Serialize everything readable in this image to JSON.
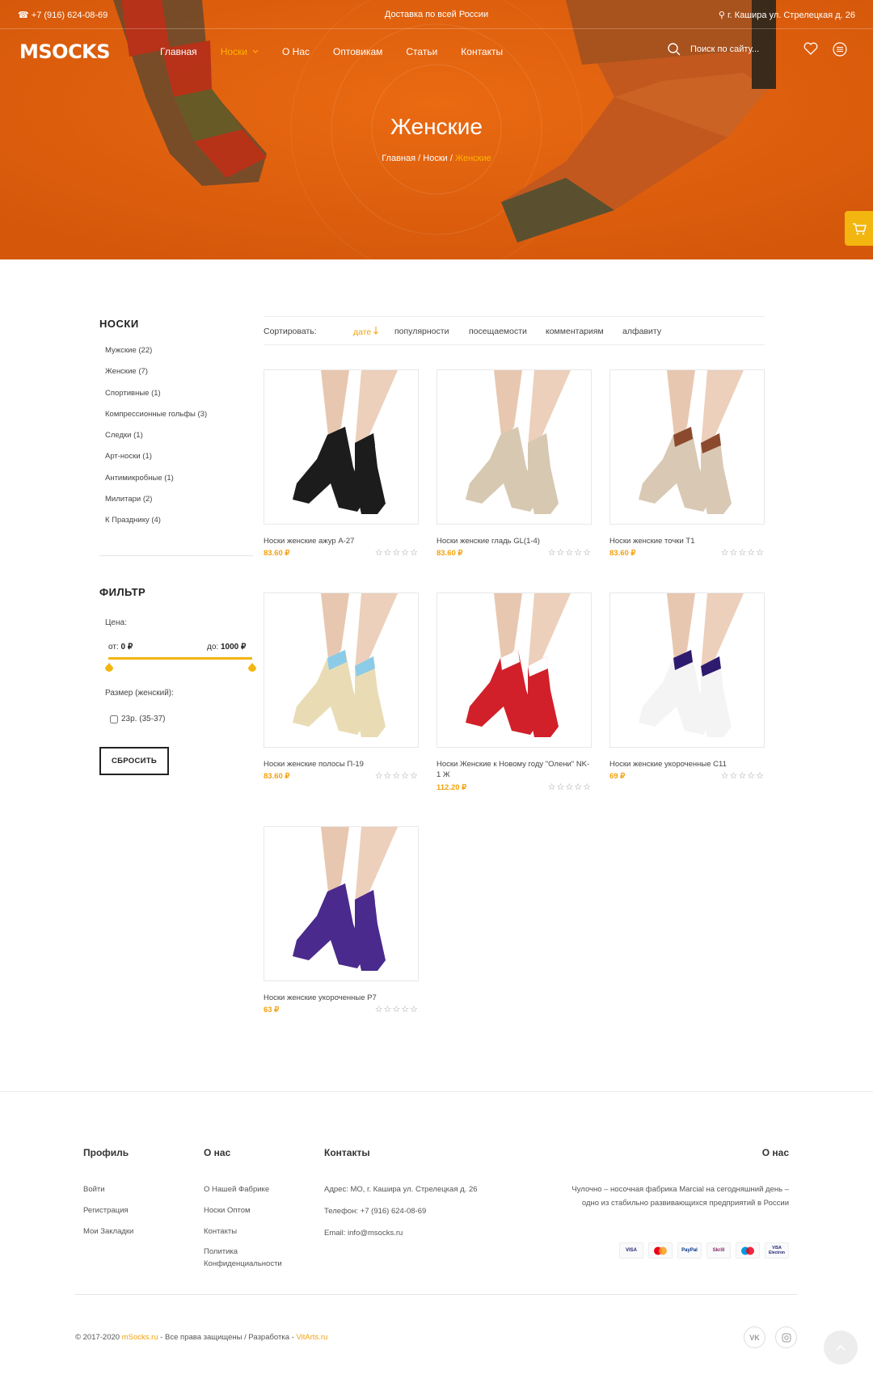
{
  "topbar": {
    "phone": "+7 (916) 624-08-69",
    "delivery": "Доставка по всей России",
    "address": "г. Кашира ул. Стрелецкая д. 26"
  },
  "header": {
    "logo": "MSOCKS",
    "menu": [
      "Главная",
      "Носки",
      "О Нас",
      "Оптовикам",
      "Статьи",
      "Контакты"
    ],
    "search_placeholder": "Поиск по сайту..."
  },
  "hero": {
    "title": "Женские",
    "breadcrumb": [
      "Главная",
      "Носки",
      "Женские"
    ]
  },
  "sidebar": {
    "categories_title": "НОСКИ",
    "categories": [
      "Мужские (22)",
      "Женские (7)",
      "Спортивные (1)",
      "Компрессионные гольфы (3)",
      "Следки (1)",
      "Арт-носки (1)",
      "Антимикробные (1)",
      "Милитари (2)",
      "К Празднику (4)"
    ],
    "filter_title": "ФИЛЬТР",
    "price_label": "Цена:",
    "price_from_label": "от:",
    "price_from": "0 ₽",
    "price_to_label": "до:",
    "price_to": "1000 ₽",
    "size_label": "Размер (женский):",
    "size_option": "23р. (35-37)",
    "reset": "СБРОСИТЬ"
  },
  "sort": {
    "label": "Сортировать:",
    "options": [
      "дате",
      "популярности",
      "посещаемости",
      "комментариям",
      "алфавиту"
    ],
    "active": "дате"
  },
  "products": [
    {
      "name": "Носки женские ажур А-27",
      "price": "83.60 ₽",
      "stars": "☆☆☆☆☆",
      "color": "#1c1c1c",
      "cuff": "#1c1c1c"
    },
    {
      "name": "Носки женские гладь GL(1-4)",
      "price": "83.60 ₽",
      "stars": "☆☆☆☆☆",
      "color": "#d7c8b2",
      "cuff": "#d7c8b2"
    },
    {
      "name": "Носки женские точки Т1",
      "price": "83.60 ₽",
      "stars": "☆☆☆☆☆",
      "color": "#d9c9b4",
      "cuff": "#8b4a2e"
    },
    {
      "name": "Носки женские полосы П-19",
      "price": "83.60 ₽",
      "stars": "☆☆☆☆☆",
      "color": "#e9dcb5",
      "cuff": "#8ccbe8"
    },
    {
      "name": "Носки Женские к Новому году \"Олени\" NK-1 Ж",
      "price": "112.20 ₽",
      "stars": "☆☆☆☆☆",
      "color": "#d1202a",
      "cuff": "#ffffff"
    },
    {
      "name": "Носки женские укороченные С11",
      "price": "69 ₽",
      "stars": "☆☆☆☆☆",
      "color": "#f4f4f4",
      "cuff": "#2e1a6e"
    },
    {
      "name": "Носки женские укороченные Р7",
      "price": "63 ₽",
      "stars": "☆☆☆☆☆",
      "color": "#4a2a8c",
      "cuff": "#4a2a8c"
    }
  ],
  "footer": {
    "profile_title": "Профиль",
    "profile_links": [
      "Войти",
      "Регистрация",
      "Мои Закладки"
    ],
    "about_title": "О нас",
    "about_links": [
      "О Нашей Фабрике",
      "Носки Оптом",
      "Контакты",
      "Политика Конфиденциальности"
    ],
    "contacts_title": "Контакты",
    "contacts": [
      "Адрес: МО, г. Кашира ул. Стрелецкая д. 26",
      "Телефон: +7 (916) 624-08-69",
      "Email: info@msocks.ru"
    ],
    "about2_title": "О нас",
    "about2_text": "Чулочно – носочная фабрика Marcial на сегодняшний день – одно из стабильно развивающихся предприятий в России",
    "payments": [
      "VISA",
      "MC",
      "PayPal",
      "Skrill",
      "Maestro",
      "VISA Electron"
    ],
    "copyright_prefix": "© 2017-2020",
    "site": "mSocks.ru",
    "copyright_mid": "- Все права защищены / Разработка -",
    "developer": "VitArts.ru",
    "social": [
      "VK",
      "IG"
    ]
  },
  "colors": {
    "accent": "#f3a20f",
    "hero": "#e2600e",
    "cart": "#f3b50f"
  }
}
